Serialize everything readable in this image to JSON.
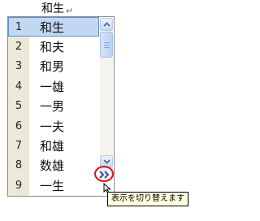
{
  "composition": {
    "text": "和生",
    "paragraph_mark": "↵"
  },
  "candidates": [
    {
      "index": "1",
      "text": "和生",
      "selected": true
    },
    {
      "index": "2",
      "text": "和夫",
      "selected": false
    },
    {
      "index": "3",
      "text": "和男",
      "selected": false
    },
    {
      "index": "4",
      "text": "一雄",
      "selected": false
    },
    {
      "index": "5",
      "text": "一男",
      "selected": false
    },
    {
      "index": "6",
      "text": "一夫",
      "selected": false
    },
    {
      "index": "7",
      "text": "和雄",
      "selected": false
    },
    {
      "index": "8",
      "text": "数雄",
      "selected": false
    },
    {
      "index": "9",
      "text": "一生",
      "selected": false
    }
  ],
  "scrollbar": {
    "up_icon": "chevron-up-icon",
    "down_icon": "chevron-down-icon"
  },
  "expand_button": {
    "icon": "double-chevron-right-icon",
    "highlight_color": "#e0101a"
  },
  "tooltip": {
    "text": "表示を切り替えます"
  },
  "colors": {
    "selection": "#c2d7f2",
    "selection_border": "#5e8ecf",
    "index_column": "#ece9d8"
  }
}
